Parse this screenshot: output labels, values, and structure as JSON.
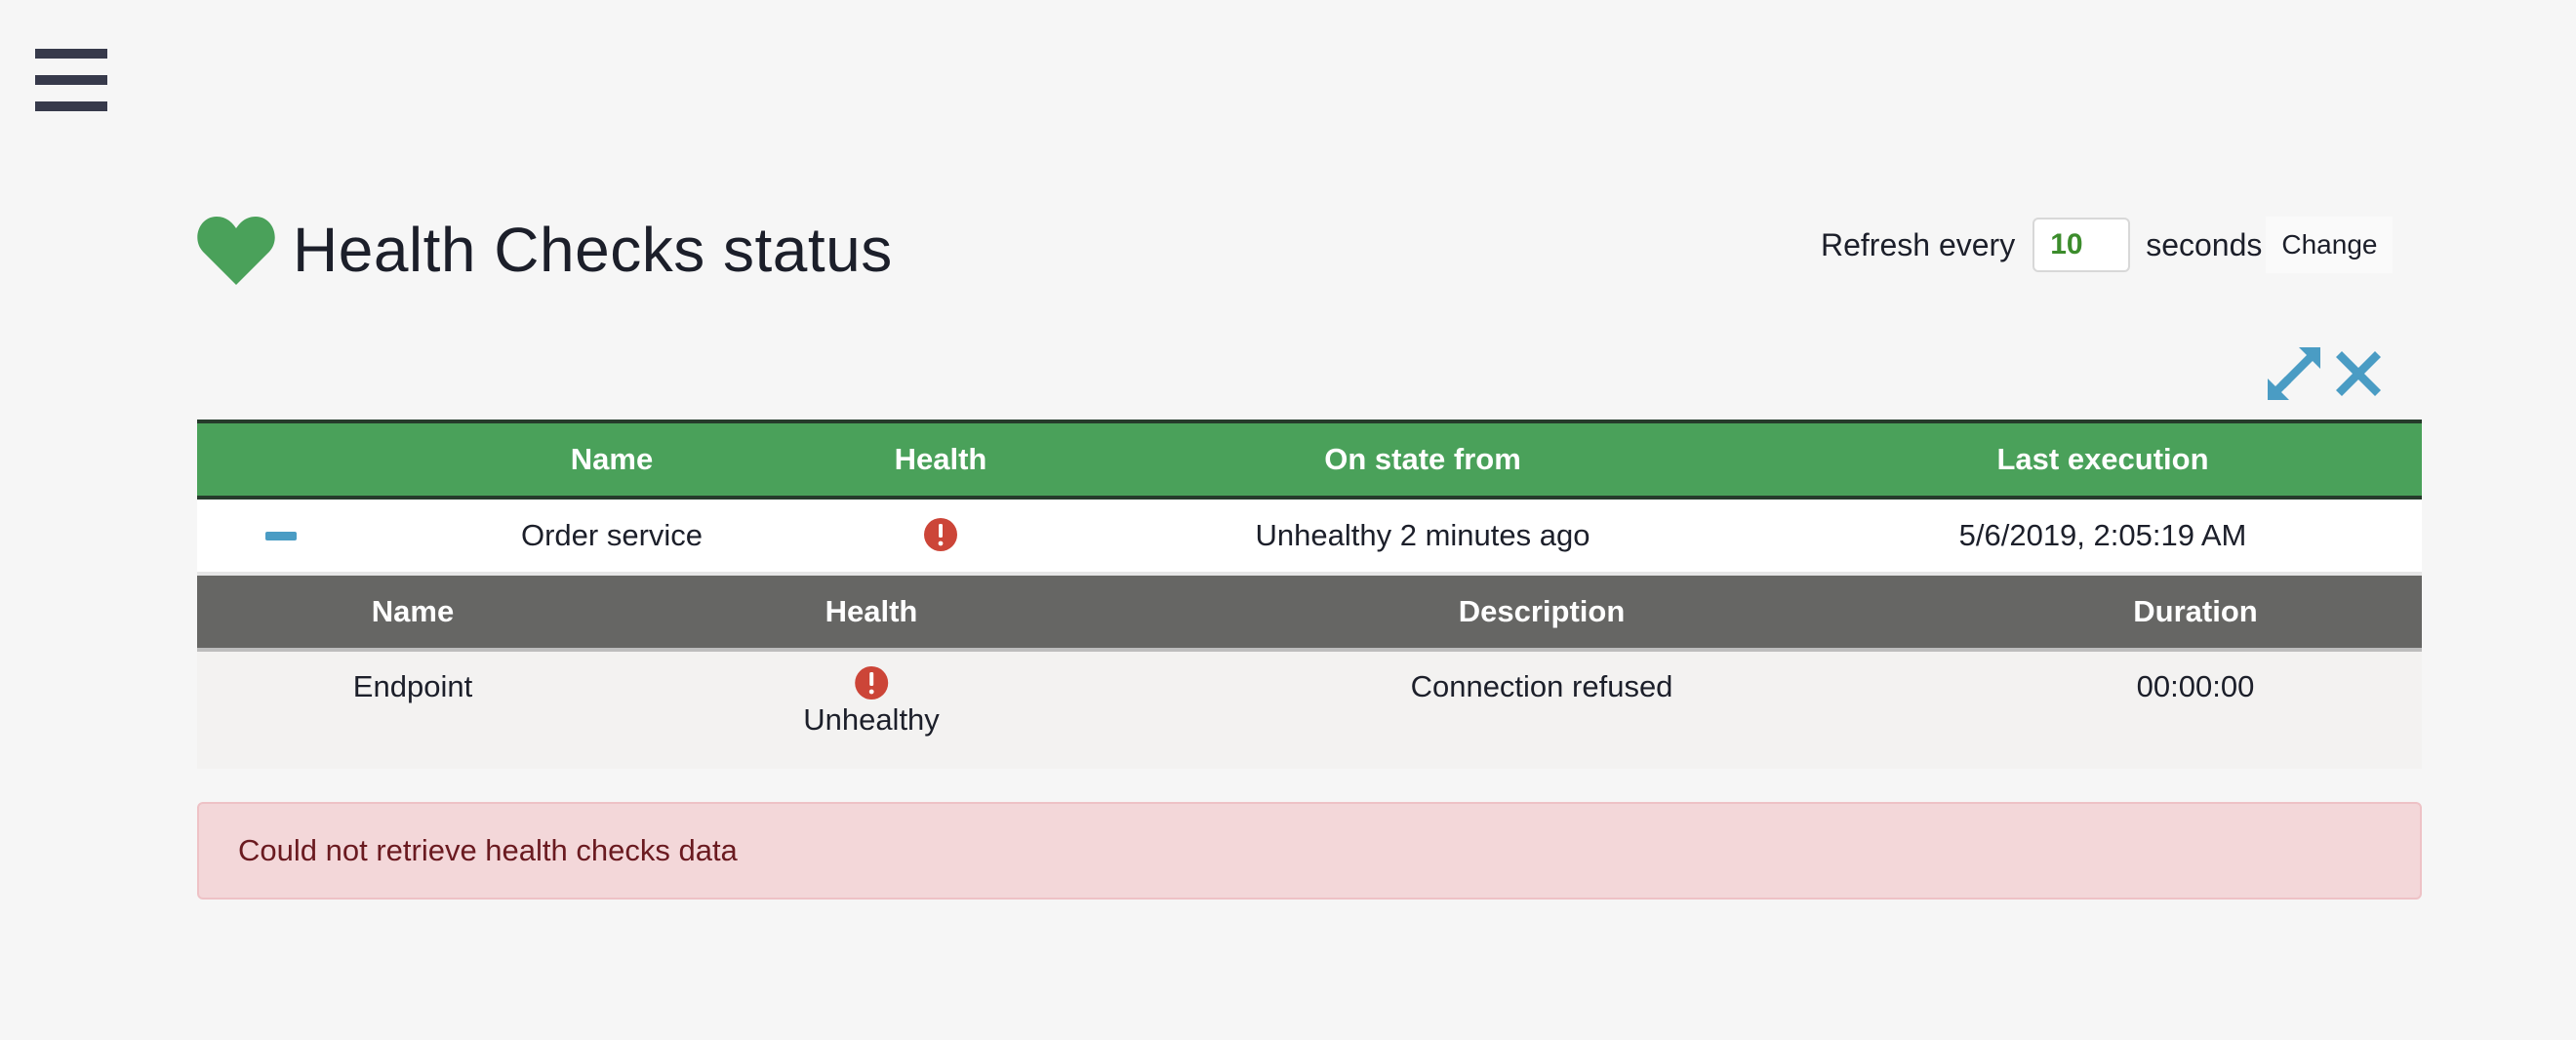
{
  "header": {
    "title": "Health Checks status",
    "refresh_prefix": "Refresh every",
    "refresh_value": "10",
    "refresh_suffix": "seconds",
    "change_label": "Change"
  },
  "colors": {
    "accent": "#4aa15a",
    "link": "#4a9cc4",
    "error": "#cc4538",
    "alert_bg": "#f3d7d9"
  },
  "icons": {
    "menu": "hamburger-icon",
    "heart": "heart-icon",
    "expand": "expand-icon",
    "close": "close-icon",
    "collapse": "minus-icon",
    "error": "exclamation-circle-icon"
  },
  "table": {
    "columns": [
      "Name",
      "Health",
      "On state from",
      "Last execution"
    ],
    "rows": [
      {
        "name": "Order service",
        "health": "Unhealthy",
        "on_state_from": "Unhealthy 2 minutes ago",
        "last_execution": "5/6/2019, 2:05:19 AM",
        "detail": {
          "columns": [
            "Name",
            "Health",
            "Description",
            "Duration"
          ],
          "rows": [
            {
              "name": "Endpoint",
              "health": "Unhealthy",
              "description": "Connection refused",
              "duration": "00:00:00"
            }
          ]
        }
      }
    ]
  },
  "alert": {
    "message": "Could not retrieve health checks data"
  }
}
